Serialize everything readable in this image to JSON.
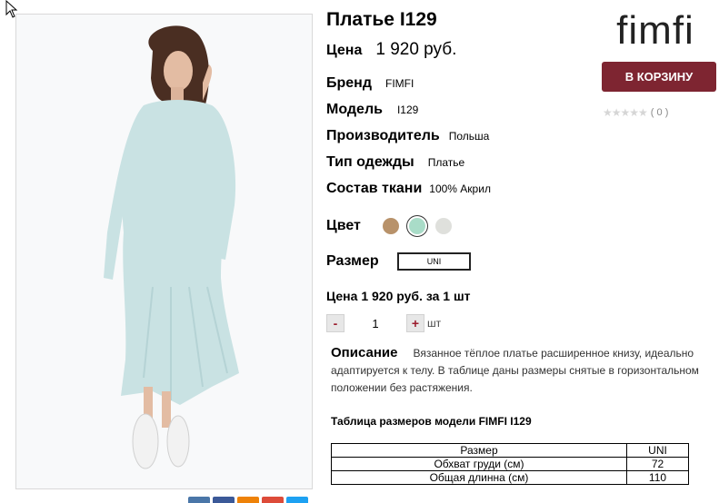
{
  "product": {
    "title": "Платье I129",
    "price_label": "Цена",
    "price_value": "1 920 руб."
  },
  "attributes": [
    {
      "key": "Бренд",
      "value": "FIMFI"
    },
    {
      "key": "Модель",
      "value": "I129"
    },
    {
      "key": "Производитель",
      "value": "Польша"
    },
    {
      "key": "Тип одежды",
      "value": "Платье"
    },
    {
      "key": "Состав ткани",
      "value": "100% Акрил"
    }
  ],
  "color": {
    "label": "Цвет",
    "swatches": [
      "#b8926a",
      "#a9dcc8",
      "#dfe0dc"
    ],
    "selected_index": 1
  },
  "size": {
    "label": "Размер",
    "selected": "UNI"
  },
  "unit_price": "Цена 1 920 руб. за 1 шт",
  "quantity": {
    "minus": "-",
    "value": "1",
    "plus": "+",
    "unit": "шт"
  },
  "description": {
    "heading": "Описание",
    "text": "Вязанное тёплое платье расширенное книзу, идеально адаптируется к телу. В таблице даны размеры снятые в горизонтальном положении без растяжения."
  },
  "size_table": {
    "title": "Таблица размеров модели FIMFI  I129",
    "header": [
      "Размер",
      "UNI"
    ],
    "rows": [
      [
        "Обхват груди (см)",
        "72"
      ],
      [
        "Общая длинна (см)",
        "110"
      ]
    ]
  },
  "brand_logo": "fimfi",
  "cart_button": "В КОРЗИНУ",
  "rating": {
    "stars": "★★★★★",
    "count": "( 0 )",
    "value": 0
  },
  "share_colors": [
    "#4a76a8",
    "#3b5998",
    "#ee8208",
    "#dd4b39",
    "#1da1f2"
  ]
}
